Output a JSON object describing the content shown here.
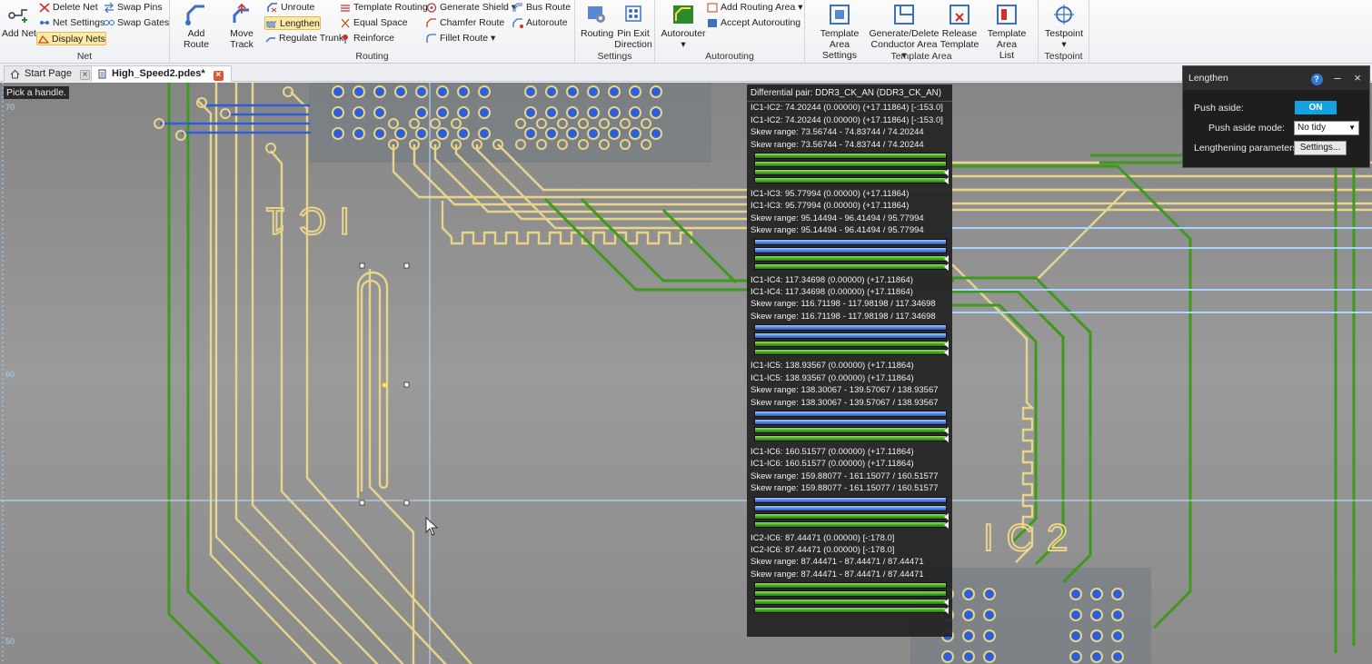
{
  "ribbon": {
    "net_group": {
      "label": "Net",
      "add_net": "Add Net",
      "delete_net": "Delete Net",
      "net_settings": "Net Settings",
      "display_nets": "Display Nets",
      "swap_pins": "Swap Pins",
      "swap_gates": "Swap Gates"
    },
    "routing_group": {
      "label": "Routing",
      "add_route": "Add Route",
      "move_track": "Move Track",
      "unroute": "Unroute",
      "lengthen": "Lengthen",
      "regulate_trunk": "Regulate Trunk",
      "template_routing": "Template Routing",
      "equal_space": "Equal Space",
      "reinforce": "Reinforce",
      "generate_shield": "Generate Shield",
      "chamfer_route": "Chamfer Route",
      "fillet_route": "Fillet Route",
      "bus_route": "Bus Route",
      "autoroute": "Autoroute"
    },
    "settings_group": {
      "label": "Settings",
      "routing": "Routing",
      "pin_exit_1": "Pin Exit",
      "pin_exit_2": "Direction"
    },
    "autorouting_group": {
      "label": "Autorouting",
      "autorouter": "Autorouter",
      "add_routing_area": "Add Routing Area",
      "accept_autorouting": "Accept Autorouting"
    },
    "template_area_group": {
      "label": "Template Area",
      "tas_1": "Template Area",
      "tas_2": "Settings",
      "gd_1": "Generate/Delete",
      "gd_2": "Conductor Area",
      "rt_1": "Release",
      "rt_2": "Template",
      "tal_1": "Template Area",
      "tal_2": "List"
    },
    "testpoint_group": {
      "label": "Testpoint",
      "testpoint": "Testpoint"
    }
  },
  "tabs": [
    {
      "label": "Start Page",
      "active": false
    },
    {
      "label": "High_Speed2.pdes*",
      "active": true
    }
  ],
  "canvas": {
    "hint": "Pick a handle.",
    "ruler_labels": [
      "70",
      "60",
      "50"
    ],
    "ic_labels": [
      "IC1",
      "IC2"
    ]
  },
  "diff_panel": {
    "title": "Differential pair: DDR3_CK_AN (DDR3_CK_AN)",
    "groups": [
      {
        "lines": [
          "IC1-IC2: 74.20244 (0.00000) (+17.11864) [-:153.0]",
          "IC1-IC2: 74.20244 (0.00000) (+17.11864) [-:153.0]",
          "Skew range: 73.56744 - 74.83744 / 74.20244",
          "Skew range: 73.56744 - 74.83744 / 74.20244"
        ],
        "bar_color": "g"
      },
      {
        "lines": [
          "IC1-IC3: 95.77994 (0.00000) (+17.11864)",
          "IC1-IC3: 95.77994 (0.00000) (+17.11864)",
          "Skew range: 95.14494 - 96.41494 / 95.77994",
          "Skew range: 95.14494 - 96.41494 / 95.77994"
        ],
        "bar_color": "b"
      },
      {
        "lines": [
          "IC1-IC4: 117.34698 (0.00000) (+17.11864)",
          "IC1-IC4: 117.34698 (0.00000) (+17.11864)",
          "Skew range: 116.71198 - 117.98198 / 117.34698",
          "Skew range: 116.71198 - 117.98198 / 117.34698"
        ],
        "bar_color": "b"
      },
      {
        "lines": [
          "IC1-IC5: 138.93567 (0.00000) (+17.11864)",
          "IC1-IC5: 138.93567 (0.00000) (+17.11864)",
          "Skew range: 138.30067 - 139.57067 / 138.93567",
          "Skew range: 138.30067 - 139.57067 / 138.93567"
        ],
        "bar_color": "b"
      },
      {
        "lines": [
          "IC1-IC6: 160.51577 (0.00000) (+17.11864)",
          "IC1-IC6: 160.51577 (0.00000) (+17.11864)",
          "Skew range: 159.88077 - 161.15077 / 160.51577",
          "Skew range: 159.88077 - 161.15077 / 160.51577"
        ],
        "bar_color": "b"
      },
      {
        "lines": [
          "IC2-IC6: 87.44471 (0.00000) [-:178.0]",
          "IC2-IC6: 87.44471 (0.00000) [-:178.0]",
          "Skew range: 87.44471 - 87.44471 / 87.44471",
          "Skew range: 87.44471 - 87.44471 / 87.44471"
        ],
        "bar_color": "g"
      }
    ]
  },
  "lengthen_panel": {
    "title": "Lengthen",
    "push_aside_label": "Push aside:",
    "push_aside_value": "ON",
    "push_mode_label": "Push aside mode:",
    "push_mode_value": "No tidy",
    "params_label": "Lengthening parameters:",
    "settings_button": "Settings..."
  },
  "colors": {
    "board_green": "#3d9a1a",
    "trace_yellow": "#e8d58a",
    "via_blue": "#2e5fd8",
    "toggle_on": "#15a0e3"
  }
}
